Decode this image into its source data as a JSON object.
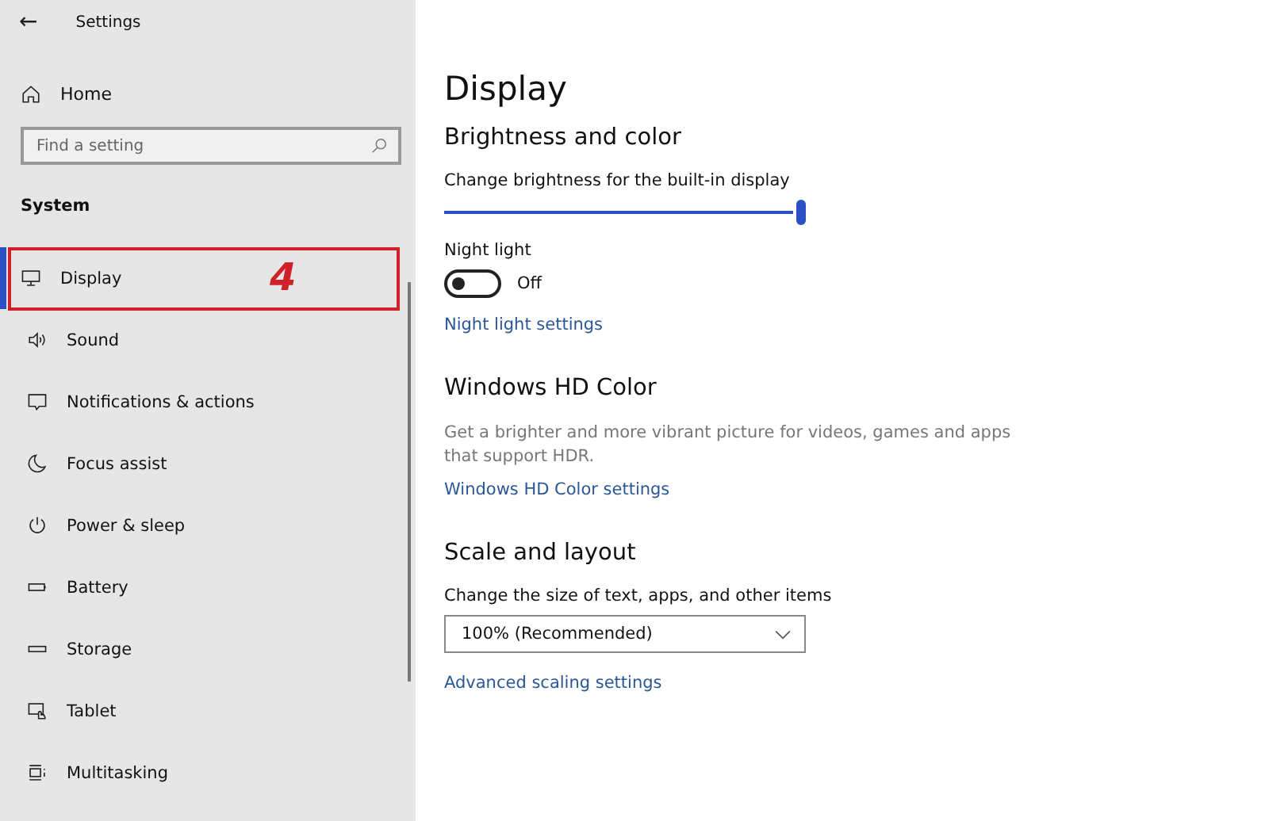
{
  "window": {
    "title": "Settings",
    "back": "←"
  },
  "sidebar": {
    "home": "Home",
    "search": {
      "placeholder": "Find a setting"
    },
    "section": "System",
    "annotation_label": "4",
    "items": [
      {
        "label": "Display",
        "kind": "display",
        "selected": true,
        "annotated": true
      },
      {
        "label": "Sound",
        "kind": "sound",
        "selected": false,
        "annotated": false
      },
      {
        "label": "Notifications & actions",
        "kind": "notifications",
        "selected": false,
        "annotated": false
      },
      {
        "label": "Focus assist",
        "kind": "focus",
        "selected": false,
        "annotated": false
      },
      {
        "label": "Power & sleep",
        "kind": "power",
        "selected": false,
        "annotated": false
      },
      {
        "label": "Battery",
        "kind": "battery",
        "selected": false,
        "annotated": false
      },
      {
        "label": "Storage",
        "kind": "storage",
        "selected": false,
        "annotated": false
      },
      {
        "label": "Tablet",
        "kind": "tablet",
        "selected": false,
        "annotated": false
      },
      {
        "label": "Multitasking",
        "kind": "multitasking",
        "selected": false,
        "annotated": false
      }
    ]
  },
  "page": {
    "title": "Display",
    "sections": [
      {
        "heading": "Brightness and color",
        "controls": [
          {
            "kind": "slider",
            "label": "Change brightness for the built-in display",
            "level": 1.0
          },
          {
            "kind": "toggle",
            "label": "Night light",
            "on": false,
            "state_text": "Off"
          },
          {
            "kind": "link",
            "label": "Night light settings"
          }
        ]
      },
      {
        "heading": "Windows HD Color",
        "controls": [
          {
            "kind": "text",
            "label": "Get a brighter and more vibrant picture for videos, games and apps that support HDR."
          },
          {
            "kind": "link",
            "label": "Windows HD Color settings"
          }
        ]
      },
      {
        "heading": "Scale and layout",
        "controls": [
          {
            "kind": "dropdown",
            "label": "Change the size of text, apps, and other items",
            "value": "100% (Recommended)"
          },
          {
            "kind": "link",
            "label": "Advanced scaling settings"
          }
        ]
      }
    ]
  }
}
